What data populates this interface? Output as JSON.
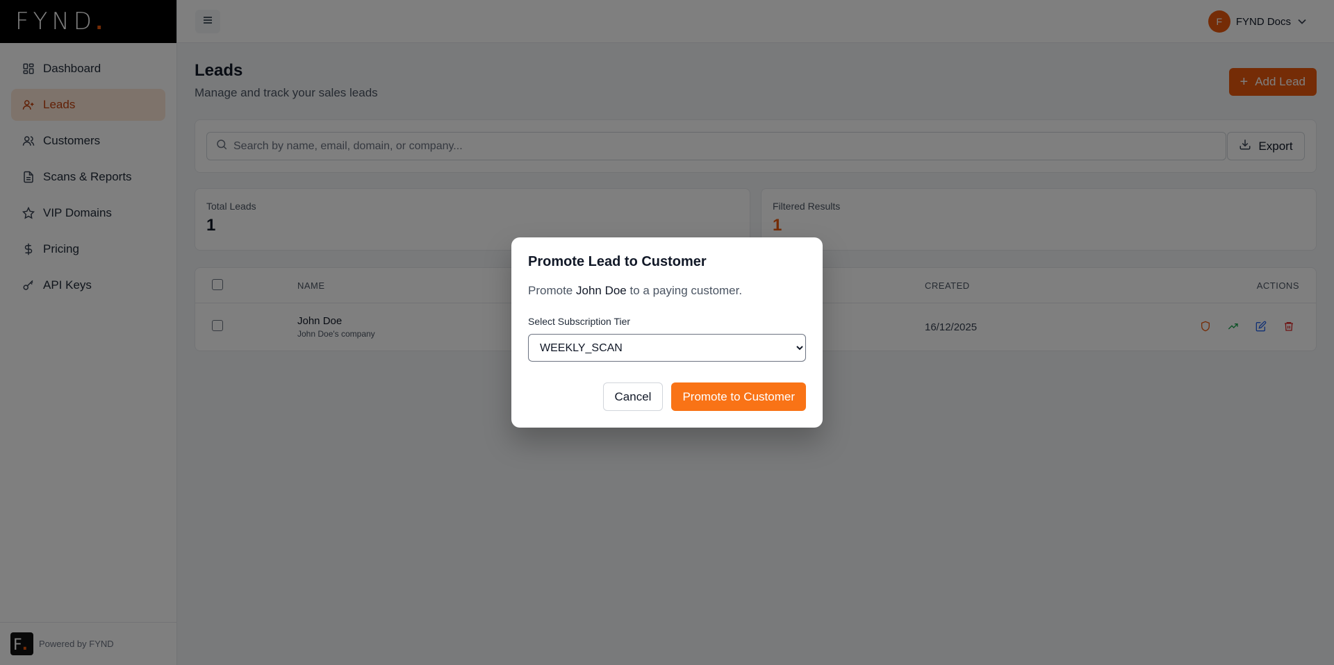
{
  "brand": {
    "name": "FYND",
    "dot": "."
  },
  "sidebar": {
    "items": [
      {
        "label": "Dashboard",
        "icon": "grid-icon"
      },
      {
        "label": "Leads",
        "icon": "user-plus-icon"
      },
      {
        "label": "Customers",
        "icon": "users-icon"
      },
      {
        "label": "Scans & Reports",
        "icon": "document-icon"
      },
      {
        "label": "VIP Domains",
        "icon": "star-icon"
      },
      {
        "label": "Pricing",
        "icon": "dollar-icon"
      },
      {
        "label": "API Keys",
        "icon": "key-icon"
      }
    ],
    "footer": {
      "badge": "F",
      "badge_dot": ".",
      "text": "Powered by FYND"
    }
  },
  "topbar": {
    "avatar_initial": "F",
    "user_name": "FYND Docs"
  },
  "page": {
    "title": "Leads",
    "subtitle": "Manage and track your sales leads",
    "add_button": "Add Lead"
  },
  "search": {
    "placeholder": "Search by name, email, domain, or company...",
    "export_label": "Export"
  },
  "stats": {
    "total_label": "Total Leads",
    "total_value": "1",
    "filtered_label": "Filtered Results",
    "filtered_value": "1"
  },
  "table": {
    "headers": {
      "name": "NAME",
      "created": "CREATED",
      "actions": "ACTIONS"
    },
    "rows": [
      {
        "name": "John Doe",
        "company": "John Doe's company",
        "created": "16/12/2025"
      }
    ]
  },
  "modal": {
    "title": "Promote Lead to Customer",
    "text_prefix": "Promote ",
    "text_name": "John Doe",
    "text_suffix": " to a paying customer.",
    "select_label": "Select Subscription Tier",
    "selected_tier": "WEEKLY_SCAN",
    "cancel_label": "Cancel",
    "confirm_label": "Promote to Customer"
  },
  "colors": {
    "accent": "#ea580c",
    "accent_light": "#f97316"
  }
}
